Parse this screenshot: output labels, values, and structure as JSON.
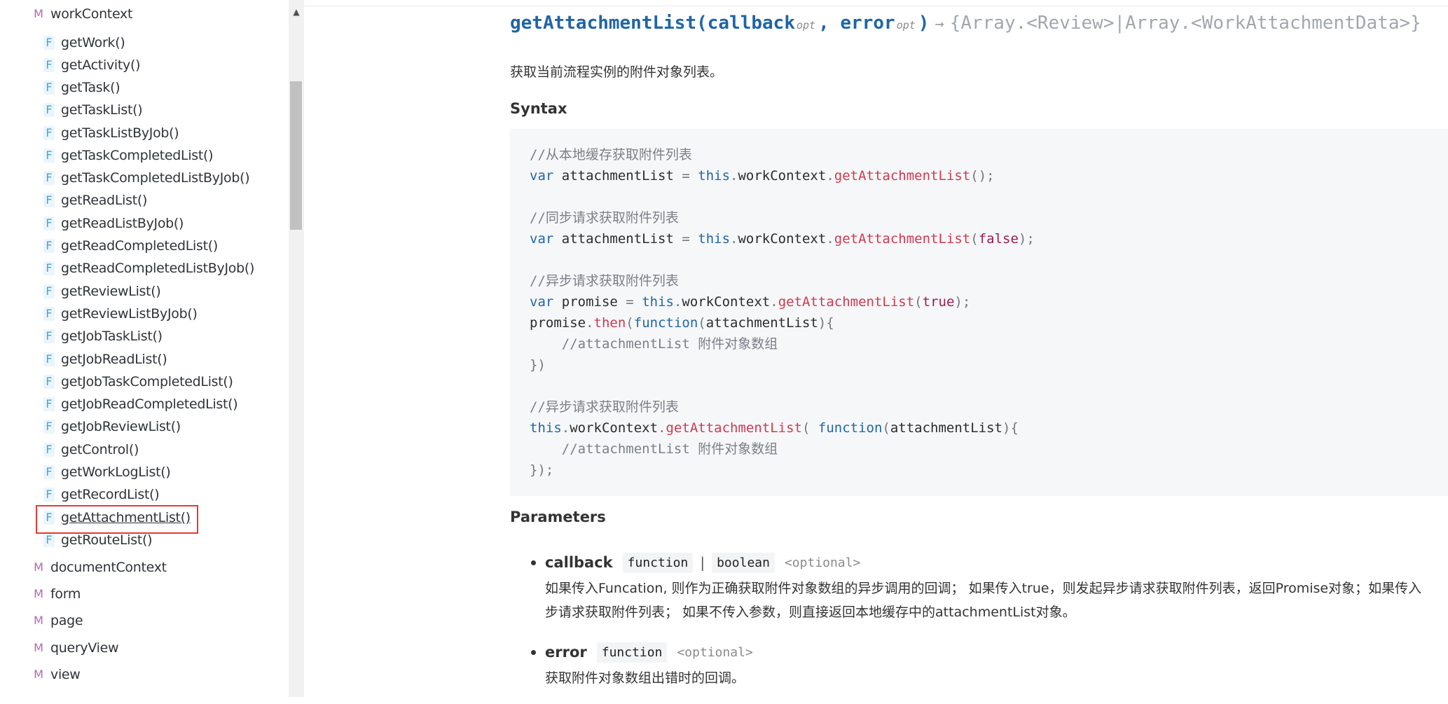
{
  "sidebar": {
    "items": [
      {
        "kind": "M",
        "label": "workContext"
      },
      {
        "kind": "F",
        "label": "getWork()"
      },
      {
        "kind": "F",
        "label": "getActivity()"
      },
      {
        "kind": "F",
        "label": "getTask()"
      },
      {
        "kind": "F",
        "label": "getTaskList()"
      },
      {
        "kind": "F",
        "label": "getTaskListByJob()"
      },
      {
        "kind": "F",
        "label": "getTaskCompletedList()"
      },
      {
        "kind": "F",
        "label": "getTaskCompletedListByJob()"
      },
      {
        "kind": "F",
        "label": "getReadList()"
      },
      {
        "kind": "F",
        "label": "getReadListByJob()"
      },
      {
        "kind": "F",
        "label": "getReadCompletedList()"
      },
      {
        "kind": "F",
        "label": "getReadCompletedListByJob()"
      },
      {
        "kind": "F",
        "label": "getReviewList()"
      },
      {
        "kind": "F",
        "label": "getReviewListByJob()"
      },
      {
        "kind": "F",
        "label": "getJobTaskList()"
      },
      {
        "kind": "F",
        "label": "getJobReadList()"
      },
      {
        "kind": "F",
        "label": "getJobTaskCompletedList()"
      },
      {
        "kind": "F",
        "label": "getJobReadCompletedList()"
      },
      {
        "kind": "F",
        "label": "getJobReviewList()"
      },
      {
        "kind": "F",
        "label": "getControl()"
      },
      {
        "kind": "F",
        "label": "getWorkLogList()"
      },
      {
        "kind": "F",
        "label": "getRecordList()"
      },
      {
        "kind": "F",
        "label": "getAttachmentList()",
        "selected": true
      },
      {
        "kind": "F",
        "label": "getRouteList()"
      },
      {
        "kind": "M",
        "label": "documentContext"
      },
      {
        "kind": "M",
        "label": "form"
      },
      {
        "kind": "M",
        "label": "page"
      },
      {
        "kind": "M",
        "label": "queryView"
      },
      {
        "kind": "M",
        "label": "view"
      }
    ],
    "scroll_up_glyph": "▲"
  },
  "signature": {
    "name": "getAttachmentList(",
    "param1": "callback",
    "opt1": "opt",
    "sep": ", ",
    "param2": "error",
    "opt2": "opt",
    "close": ")",
    "arrow": "→",
    "returns": "{Array.<Review>|Array.<WorkAttachmentData>}"
  },
  "description": "获取当前流程实例的附件对象列表。",
  "headings": {
    "syntax": "Syntax",
    "parameters": "Parameters"
  },
  "code_lines": [
    [
      [
        "c",
        "//从本地缓存获取附件列表"
      ]
    ],
    [
      [
        "k",
        "var"
      ],
      [
        "t",
        " attachmentList "
      ],
      [
        "p",
        "="
      ],
      [
        "t",
        " "
      ],
      [
        "k",
        "this"
      ],
      [
        "p",
        "."
      ],
      [
        "t",
        "workContext"
      ],
      [
        "p",
        "."
      ],
      [
        "f",
        "getAttachmentList"
      ],
      [
        "p",
        "();"
      ]
    ],
    [],
    [
      [
        "c",
        "//同步请求获取附件列表"
      ]
    ],
    [
      [
        "k",
        "var"
      ],
      [
        "t",
        " attachmentList "
      ],
      [
        "p",
        "="
      ],
      [
        "t",
        " "
      ],
      [
        "k",
        "this"
      ],
      [
        "p",
        "."
      ],
      [
        "t",
        "workContext"
      ],
      [
        "p",
        "."
      ],
      [
        "f",
        "getAttachmentList"
      ],
      [
        "p",
        "("
      ],
      [
        "b",
        "false"
      ],
      [
        "p",
        ");"
      ]
    ],
    [],
    [
      [
        "c",
        "//异步请求获取附件列表"
      ]
    ],
    [
      [
        "k",
        "var"
      ],
      [
        "t",
        " promise "
      ],
      [
        "p",
        "="
      ],
      [
        "t",
        " "
      ],
      [
        "k",
        "this"
      ],
      [
        "p",
        "."
      ],
      [
        "t",
        "workContext"
      ],
      [
        "p",
        "."
      ],
      [
        "f",
        "getAttachmentList"
      ],
      [
        "p",
        "("
      ],
      [
        "b",
        "true"
      ],
      [
        "p",
        ");"
      ]
    ],
    [
      [
        "t",
        "promise"
      ],
      [
        "p",
        "."
      ],
      [
        "f",
        "then"
      ],
      [
        "p",
        "("
      ],
      [
        "k",
        "function"
      ],
      [
        "p",
        "("
      ],
      [
        "t",
        "attachmentList"
      ],
      [
        "p",
        "){"
      ]
    ],
    [
      [
        "t",
        "    "
      ],
      [
        "c",
        "//attachmentList 附件对象数组"
      ]
    ],
    [
      [
        "p",
        "})"
      ]
    ],
    [],
    [
      [
        "c",
        "//异步请求获取附件列表"
      ]
    ],
    [
      [
        "k",
        "this"
      ],
      [
        "p",
        "."
      ],
      [
        "t",
        "workContext"
      ],
      [
        "p",
        "."
      ],
      [
        "f",
        "getAttachmentList"
      ],
      [
        "p",
        "( "
      ],
      [
        "k",
        "function"
      ],
      [
        "p",
        "("
      ],
      [
        "t",
        "attachmentList"
      ],
      [
        "p",
        "){"
      ]
    ],
    [
      [
        "t",
        "    "
      ],
      [
        "c",
        "//attachmentList 附件对象数组"
      ]
    ],
    [
      [
        "p",
        "});"
      ]
    ]
  ],
  "params": [
    {
      "name": "callback",
      "types": [
        "function",
        "boolean"
      ],
      "type_sep": "|",
      "optional": "<optional>",
      "desc_lines": [
        "如果传入Funcation, 则作为正确获取附件对象数组的异步调用的回调；  如果传入true，则发起异步请求获取附件列表，返回Promise对象；如果传入",
        "步请求获取附件列表；  如果不传入参数，则直接返回本地缓存中的attachmentList对象。"
      ]
    },
    {
      "name": "error",
      "types": [
        "function"
      ],
      "type_sep": "|",
      "optional": "<optional>",
      "desc_lines": [
        "获取附件对象数组出错时的回调。"
      ]
    }
  ]
}
